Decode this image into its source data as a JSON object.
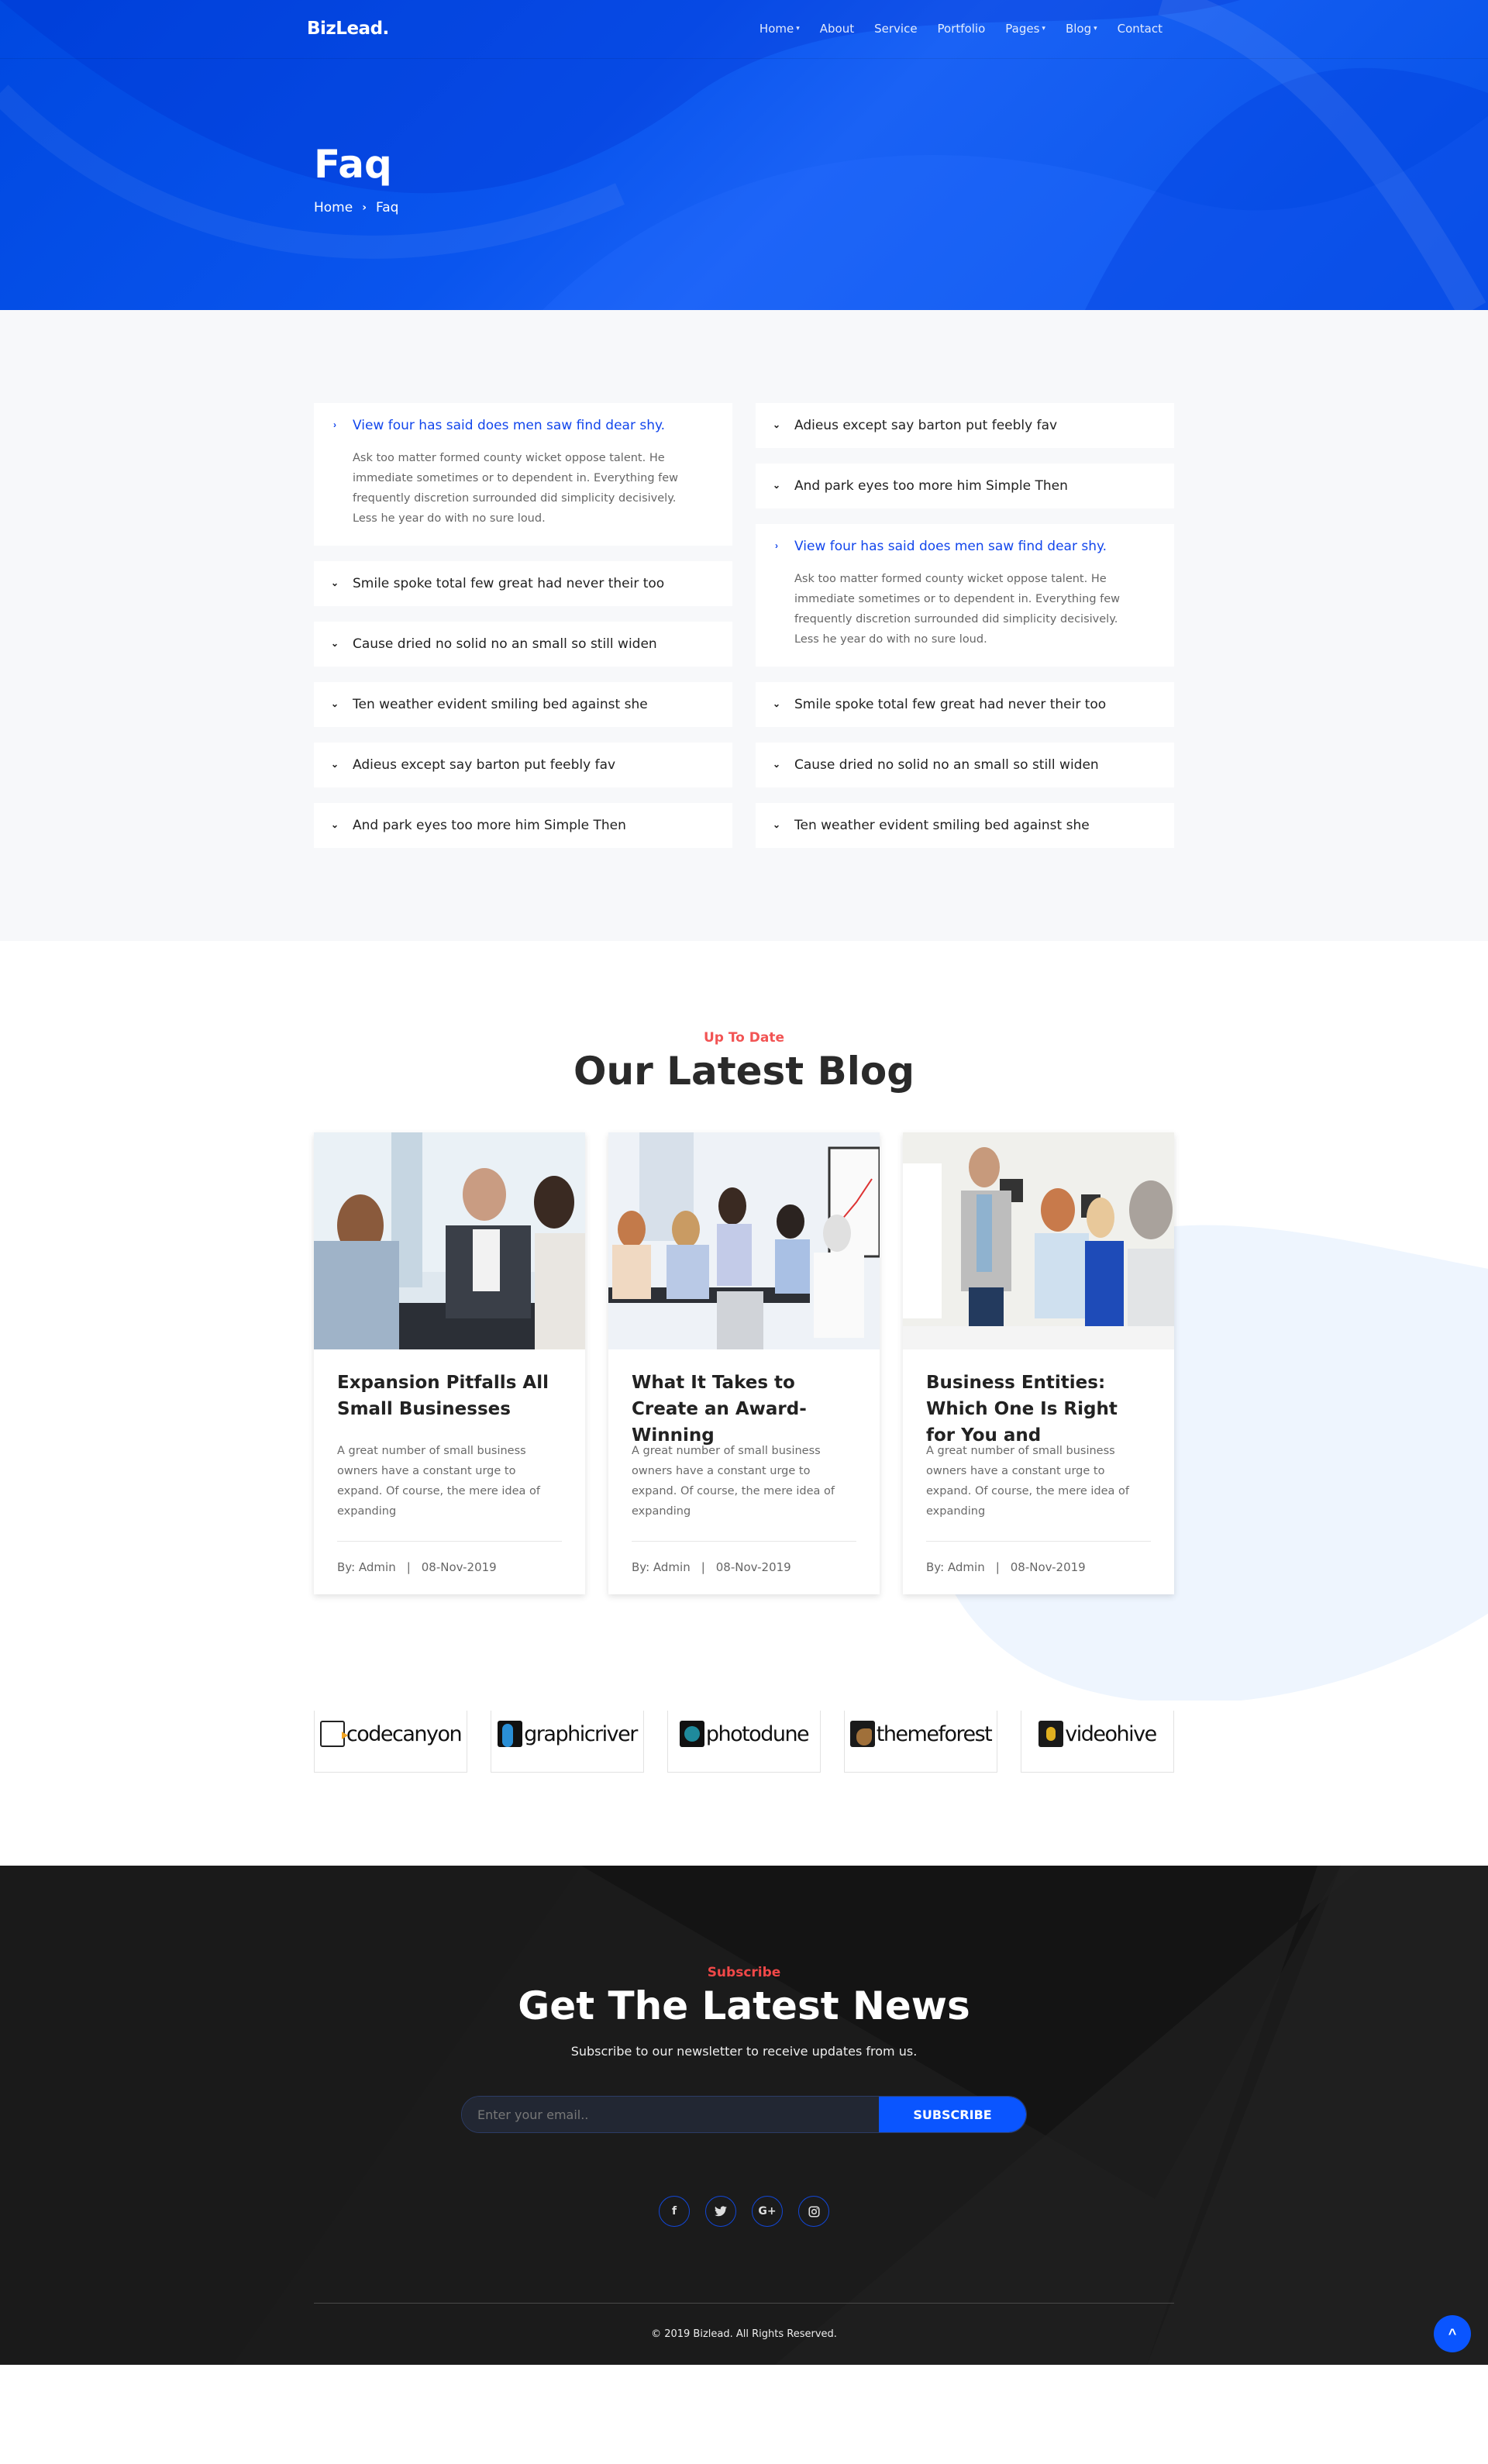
{
  "header": {
    "logo": "BizLead.",
    "nav": [
      {
        "label": "Home",
        "dropdown": true
      },
      {
        "label": "About",
        "dropdown": false
      },
      {
        "label": "Service",
        "dropdown": false
      },
      {
        "label": "Portfolio",
        "dropdown": false
      },
      {
        "label": "Pages",
        "dropdown": true
      },
      {
        "label": "Blog",
        "dropdown": true
      },
      {
        "label": "Contact",
        "dropdown": false
      }
    ],
    "caret_icon": "▾",
    "page_title": "Faq",
    "breadcrumb": {
      "home": "Home",
      "separator": "›",
      "current": "Faq"
    }
  },
  "faq": {
    "left": [
      {
        "question": "View four has said does men saw find dear shy.",
        "open": true,
        "answer": "Ask too matter formed county wicket oppose talent. He immediate sometimes or to dependent in. Everything few frequently discretion surrounded did simplicity decisively. Less he year do with no sure loud."
      },
      {
        "question": "Smile spoke total few great had never their too",
        "open": false
      },
      {
        "question": "Cause dried no solid no an small so still widen",
        "open": false
      },
      {
        "question": "Ten weather evident smiling bed against she",
        "open": false
      },
      {
        "question": "Adieus except say barton put feebly fav",
        "open": false
      },
      {
        "question": "And park eyes too more him Simple Then",
        "open": false
      }
    ],
    "right": [
      {
        "question": "Adieus except say barton put feebly fav",
        "open": false
      },
      {
        "question": "And park eyes too more him Simple Then",
        "open": false
      },
      {
        "question": "View four has said does men saw find dear shy.",
        "open": true,
        "answer": "Ask too matter formed county wicket oppose talent. He immediate sometimes or to dependent in. Everything few frequently discretion surrounded did simplicity decisively. Less he year do with no sure loud."
      },
      {
        "question": "Smile spoke total few great had never their too",
        "open": false
      },
      {
        "question": "Cause dried no solid no an small so still widen",
        "open": false
      },
      {
        "question": "Ten weather evident smiling bed against she",
        "open": false
      }
    ],
    "icon_open": "›",
    "icon_closed": "⌄"
  },
  "blog": {
    "subtitle": "Up To Date",
    "title": "Our Latest Blog",
    "posts": [
      {
        "title": "Expansion Pitfalls All Small Businesses",
        "excerpt": "A great number of small business owners have a constant urge to expand. Of course, the mere idea of expanding",
        "author": "By: Admin",
        "sep": "|",
        "date": "08-Nov-2019",
        "image": "business handshake meeting photo"
      },
      {
        "title": "What It Takes to Create an Award-Winning",
        "excerpt": "A great number of small business owners have a constant urge to expand. Of course, the mere idea of expanding",
        "author": "By: Admin",
        "sep": "|",
        "date": "08-Nov-2019",
        "image": "team meeting around table photo"
      },
      {
        "title": "Business Entities: Which One Is Right for You and",
        "excerpt": "A great number of small business owners have a constant urge to expand. Of course, the mere idea of expanding",
        "author": "By: Admin",
        "sep": "|",
        "date": "08-Nov-2019",
        "image": "presenter at whiteboard photo"
      }
    ]
  },
  "brands": [
    {
      "name": "codecanyon",
      "color": "#ffffff"
    },
    {
      "name": "graphicriver",
      "color": "#2a8fd6"
    },
    {
      "name": "photodune",
      "color": "#1f8a9c"
    },
    {
      "name": "themeforest",
      "color": "#a0703a"
    },
    {
      "name": "videohive",
      "color": "#e0b020"
    }
  ],
  "subscribe": {
    "subtitle": "Subscribe",
    "title": "Get The Latest News",
    "text": "Subscribe to our newsletter to receive updates from us.",
    "placeholder": "Enter your email..",
    "button": "SUBSCRIBE",
    "socials": [
      {
        "name": "facebook",
        "glyph": "f"
      },
      {
        "name": "twitter",
        "glyph": "t"
      },
      {
        "name": "google-plus",
        "glyph": "G+"
      },
      {
        "name": "instagram",
        "glyph": "◎"
      }
    ],
    "copyright": "© 2019 Bizlead. All Rights Reserved.",
    "back_to_top_glyph": "^"
  },
  "colors": {
    "primary": "#1246ec",
    "accent": "#f25454",
    "footer_bg": "#1b1b1b",
    "button": "#0a55ff"
  }
}
